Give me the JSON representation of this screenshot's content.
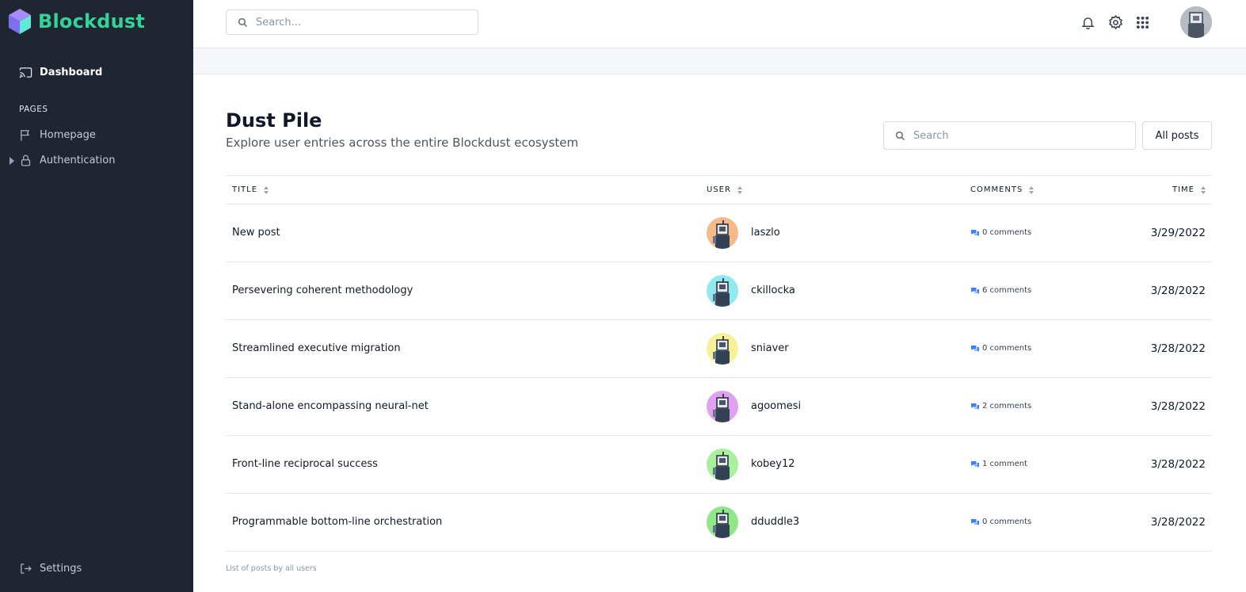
{
  "sidebar": {
    "brand": "Blockdust",
    "dashboard": "Dashboard",
    "section": "PAGES",
    "items": [
      {
        "label": "Homepage",
        "icon": "flag-icon"
      },
      {
        "label": "Authentication",
        "icon": "lock-icon"
      }
    ],
    "settings": "Settings"
  },
  "topbar": {
    "search_placeholder": "Search..."
  },
  "main": {
    "title": "Dust Pile",
    "subtitle": "Explore user entries across the entire Blockdust ecosystem",
    "search_placeholder": "Search",
    "filter_button": "All posts",
    "columns": [
      "TITLE",
      "USER",
      "COMMENTS",
      "TIME"
    ],
    "rows": [
      {
        "title": "New post",
        "user": "laszlo",
        "comments": "0 comments",
        "time": "3/29/2022",
        "avatar_color": "#f5b98a"
      },
      {
        "title": "Persevering coherent methodology",
        "user": "ckillocka",
        "comments": "6 comments",
        "time": "3/28/2022",
        "avatar_color": "#8fe9ee"
      },
      {
        "title": "Streamlined executive migration",
        "user": "sniaver",
        "comments": "0 comments",
        "time": "3/28/2022",
        "avatar_color": "#f7f29a"
      },
      {
        "title": "Stand-alone encompassing neural-net",
        "user": "agoomesi",
        "comments": "2 comments",
        "time": "3/28/2022",
        "avatar_color": "#e0a2f0"
      },
      {
        "title": "Front-line reciprocal success",
        "user": "kobey12",
        "comments": "1 comment",
        "time": "3/28/2022",
        "avatar_color": "#a8ef9e"
      },
      {
        "title": "Programmable bottom-line orchestration",
        "user": "dduddle3",
        "comments": "0 comments",
        "time": "3/28/2022",
        "avatar_color": "#8ee88a"
      }
    ],
    "caption": "List of posts by all users"
  },
  "colors": {
    "sidebar_bg": "#1f2531",
    "brand": "#34d399",
    "comment_icon": "#3b82f6"
  }
}
